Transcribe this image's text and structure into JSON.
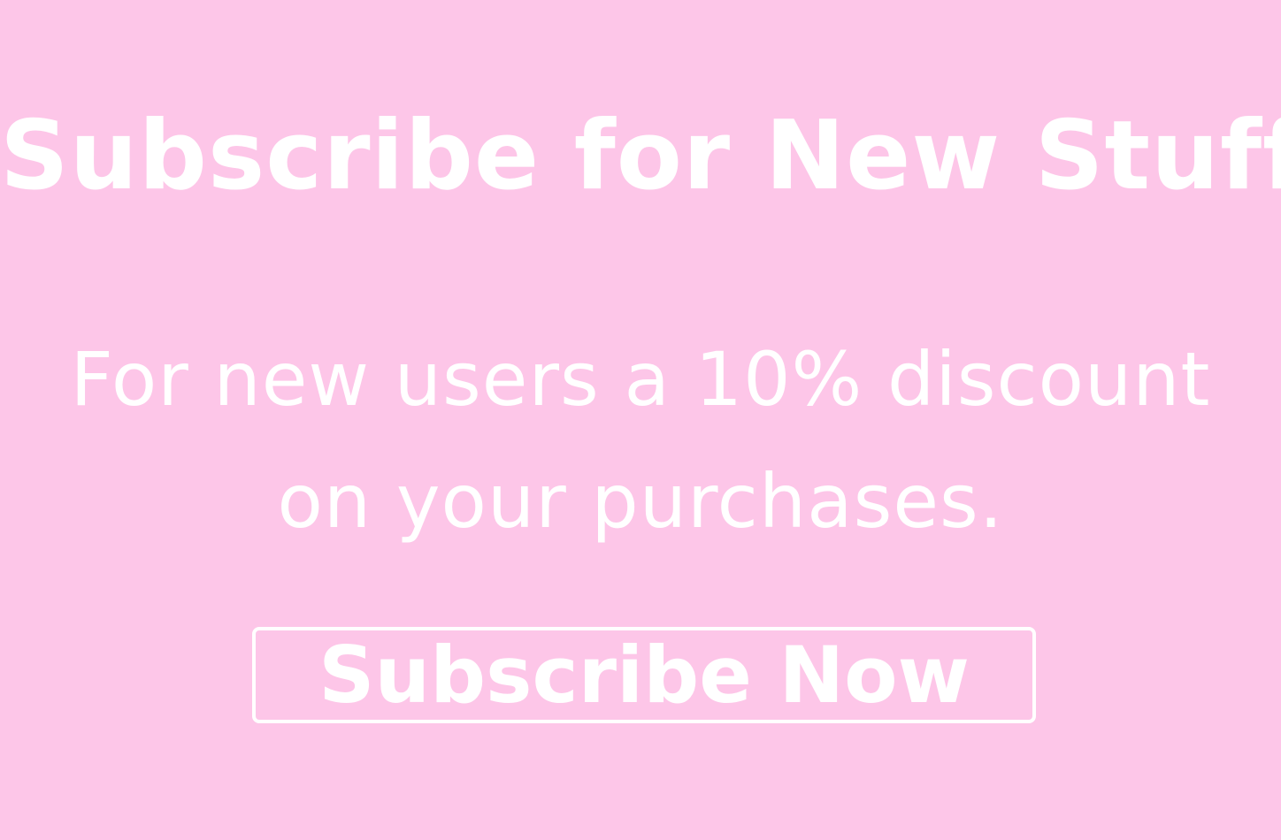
{
  "banner": {
    "headline": "Subscribe for New Stuff",
    "subtitle_line_1": "For new users a 10% discount",
    "subtitle_line_2": "on your purchases.",
    "button_label": "Subscribe Now"
  },
  "colors": {
    "background": "#fdc6e8",
    "text": "#ffffff",
    "button_border": "#ffffff"
  }
}
